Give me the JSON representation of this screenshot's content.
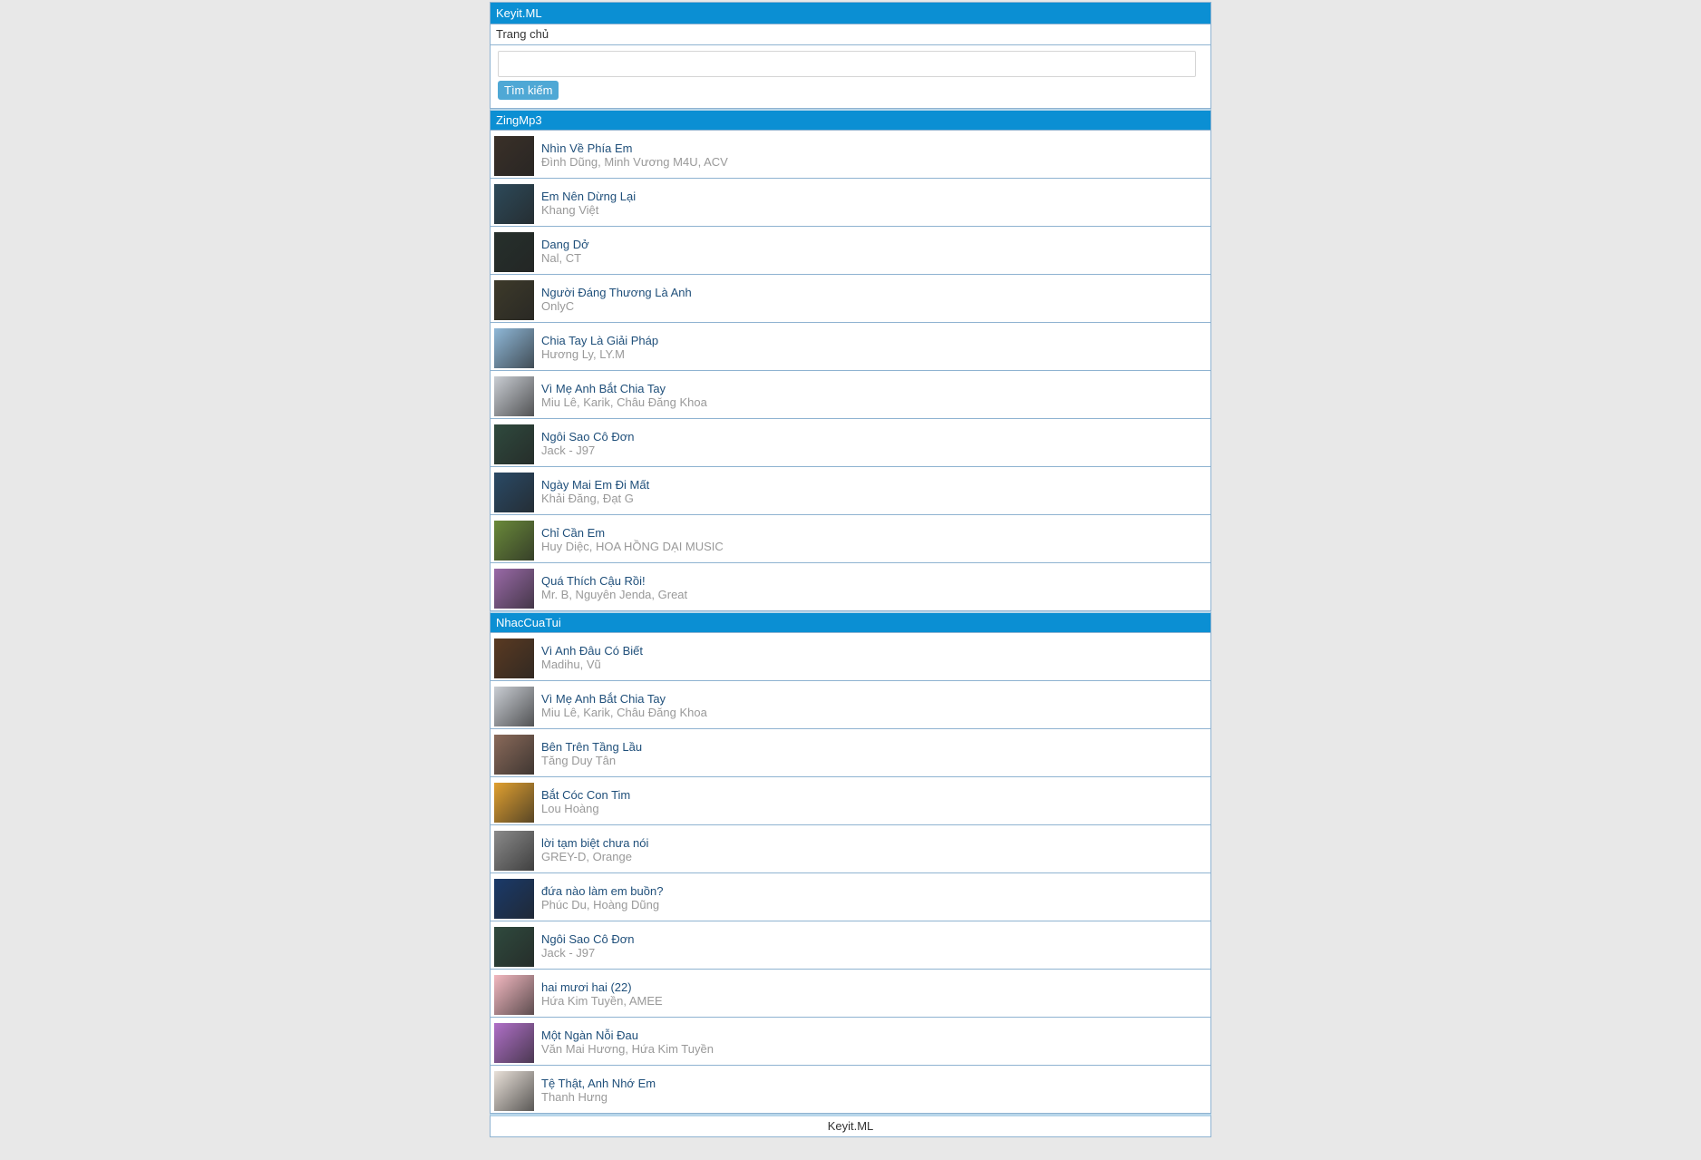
{
  "site": {
    "title": "Keyit.ML",
    "home_label": "Trang chủ",
    "footer": "Keyit.ML"
  },
  "search": {
    "placeholder": "",
    "button_label": "Tìm kiếm"
  },
  "sections": [
    {
      "title": "ZingMp3",
      "items": [
        {
          "title": "Nhìn Về Phía Em",
          "artist": "Đình Dũng, Minh Vương M4U, ACV",
          "thumb": "#3a3028"
        },
        {
          "title": "Em Nên Dừng Lại",
          "artist": "Khang Việt",
          "thumb": "#2d4a5a"
        },
        {
          "title": "Dang Dở",
          "artist": "Nal, CT",
          "thumb": "#26302c"
        },
        {
          "title": "Người Đáng Thương Là Anh",
          "artist": "OnlyC",
          "thumb": "#3d3a2a"
        },
        {
          "title": "Chia Tay Là Giải Pháp",
          "artist": "Hương Ly, LY.M",
          "thumb": "#8fb8d8"
        },
        {
          "title": "Vì Mẹ Anh Bắt Chia Tay",
          "artist": "Miu Lê, Karik, Châu Đăng Khoa",
          "thumb": "#c9cdd3"
        },
        {
          "title": "Ngôi Sao Cô Đơn",
          "artist": "Jack - J97",
          "thumb": "#2f4a3e"
        },
        {
          "title": "Ngày Mai Em Đi Mất",
          "artist": "Khải Đăng, Đạt G",
          "thumb": "#2a4a66"
        },
        {
          "title": "Chỉ Cần Em",
          "artist": "Huy Diệc, HOA HỒNG DẠI MUSIC",
          "thumb": "#6a8a3a"
        },
        {
          "title": "Quá Thích Cậu Rồi!",
          "artist": "Mr. B, Nguyên Jenda, Great",
          "thumb": "#9a6aa8"
        }
      ]
    },
    {
      "title": "NhacCuaTui",
      "items": [
        {
          "title": "Vì Anh Đâu Có Biết",
          "artist": "Madihu, Vũ",
          "thumb": "#5a3a22"
        },
        {
          "title": "Vì Mẹ Anh Bắt Chia Tay",
          "artist": "Miu Lê, Karik, Châu Đăng Khoa",
          "thumb": "#c9cdd3"
        },
        {
          "title": "Bên Trên Tầng Lầu",
          "artist": "Tăng Duy Tân",
          "thumb": "#8a6a5a"
        },
        {
          "title": "Bắt Cóc Con Tim",
          "artist": "Lou Hoàng",
          "thumb": "#e0a030"
        },
        {
          "title": "lời tạm biệt chưa nói",
          "artist": "GREY-D, Orange",
          "thumb": "#8a8a8a"
        },
        {
          "title": "đứa nào làm em buồn?",
          "artist": "Phúc Du, Hoàng Dũng",
          "thumb": "#1a3a6a"
        },
        {
          "title": "Ngôi Sao Cô Đơn",
          "artist": "Jack - J97",
          "thumb": "#2f4a3e"
        },
        {
          "title": "hai mươi hai (22)",
          "artist": "Hứa Kim Tuyền, AMEE",
          "thumb": "#f2b8c0"
        },
        {
          "title": "Một Ngàn Nỗi Đau",
          "artist": "Văn Mai Hương, Hứa Kim Tuyền",
          "thumb": "#b070c8"
        },
        {
          "title": "Tệ Thật, Anh Nhớ Em",
          "artist": "Thanh Hưng",
          "thumb": "#e8e0d8"
        }
      ]
    }
  ]
}
